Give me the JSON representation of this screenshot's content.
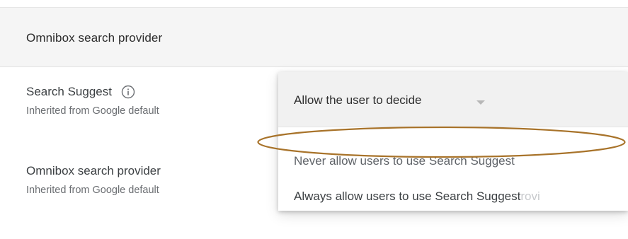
{
  "header": {
    "title": "Omnibox search provider"
  },
  "settings": [
    {
      "label": "Search Suggest",
      "sublabel": "Inherited from Google default",
      "has_info_icon": true,
      "info_icon": "info-icon"
    },
    {
      "label": "Omnibox search provider",
      "sublabel": "Inherited from Google default"
    }
  ],
  "dropdown": {
    "selected": "Allow the user to decide",
    "caret_icon": "caret-down-icon",
    "options": [
      "Never allow users to use Search Suggest",
      "Always allow users to use Search Suggest"
    ],
    "option2_ghost": "rovi"
  },
  "annotation": {
    "color": "#a8732a",
    "highlighted_option": "Never allow users to use Search Suggest"
  }
}
